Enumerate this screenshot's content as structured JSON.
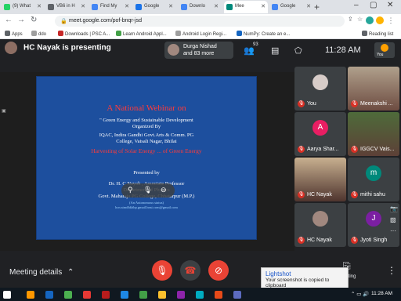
{
  "browser": {
    "tabs": [
      {
        "label": "(9) What",
        "color": "#25d366"
      },
      {
        "label": "VB6 in H",
        "color": "#5f6368"
      },
      {
        "label": "Find My",
        "color": "#4285f4"
      },
      {
        "label": "Google",
        "color": "#1a73e8"
      },
      {
        "label": "Downlo",
        "color": "#4285f4"
      },
      {
        "label": "Mee",
        "color": "#00897b"
      },
      {
        "label": "Google",
        "color": "#4285f4"
      }
    ],
    "url": "meet.google.com/pof-bnqr-jsd",
    "bookmarks": [
      {
        "label": "Apps",
        "color": "#5f6368"
      },
      {
        "label": "ddo",
        "color": "#9e9e9e"
      },
      {
        "label": "Downloads | PSC A...",
        "color": "#c62828"
      },
      {
        "label": "Learn Android Appl...",
        "color": "#43a047"
      },
      {
        "label": "Android Login Regi...",
        "color": "#9e9e9e"
      },
      {
        "label": "NumPy: Create an e...",
        "color": "#1565c0"
      }
    ],
    "reading_list": "Reading list"
  },
  "meet": {
    "presenter_text": "HC Nayak is presenting",
    "join_notice": {
      "name": "Durga Nishad",
      "others": "and 83 more"
    },
    "participant_count": "93",
    "clock": "11:28 AM",
    "self_label": "You",
    "slide": {
      "title": "A National Webinar on",
      "theme": "\" Green Energy and Sustainable Development",
      "organized_by": "Organized By",
      "org_line1": "IQAC, Indira Gandhi Govt.Arts & Comm. PG",
      "org_line2": "College,          Vaisali Nagar, Bhilai",
      "topic": "Harvesting of Solar Energy ... of Green Energy",
      "presented_by": "Presented by",
      "speaker": "Dr. H. C Nayak , Associate Professor",
      "dept": "Department of Physics",
      "college": "Govt. Maharaja PG College, Chhatarpur (M.P.)",
      "affil": "(An Autonomous status)",
      "email": "hcn.stmdhkhhp.gmail.hnst.com@gmail.com"
    },
    "zoom_bar": {
      "text": "meet.google.com is sharing your screen.",
      "stop": "Stop sharing",
      "hide": "Hide"
    },
    "tiles": [
      {
        "name": "You",
        "avatar": "",
        "color": "#3c4043"
      },
      {
        "name": "Meenakshi ...",
        "avatar": "",
        "color": "#6d4c41"
      },
      {
        "name": "Aarya Shar...",
        "avatar": "A",
        "color": "#e91e63"
      },
      {
        "name": "IGGCV Vais...",
        "avatar": "",
        "color": "#5d4037"
      },
      {
        "name": "HC Nayak",
        "avatar": "",
        "color": "#4e342e"
      },
      {
        "name": "mithi sahu",
        "avatar": "m",
        "color": "#00897b"
      },
      {
        "name": "HC Nayak",
        "avatar": "",
        "color": "#3c4043"
      },
      {
        "name": "Jyoti Singh",
        "avatar": "J",
        "color": "#7b1fa2"
      }
    ],
    "meeting_details": "Meeting details",
    "present_label": "Present now"
  },
  "toast": {
    "title": "Lightshot",
    "message": "Your screenshot is copied to clipboard"
  },
  "taskbar": {
    "time": "11:28 AM"
  },
  "colors": {
    "end_call": "#ea4335",
    "slide_bg": "#1d4f9e"
  }
}
